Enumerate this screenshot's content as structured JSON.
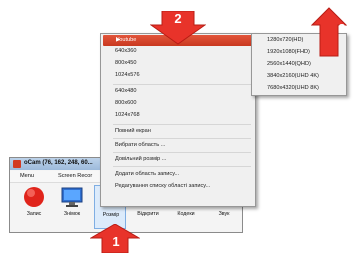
{
  "menu": {
    "highlighted_item": "Youtube",
    "items_group1": [
      "640x360",
      "800x450",
      "1024x576"
    ],
    "items_group2": [
      "640x480",
      "800x600",
      "1024x768"
    ],
    "fullscreen": "Повний екран",
    "select_area": "Вибрати область ...",
    "custom_size": "Довільний розмір ...",
    "add_area": "Додати область запису...",
    "edit_list": "Редагування списку області запису..."
  },
  "submenu": {
    "items": [
      "1280x720(HD)",
      "1920x1080(FHD)",
      "2560x1440(QHD)",
      "3840x2160(UHD 4K)",
      "7680x4320(UHD 8K)"
    ]
  },
  "window": {
    "title": "oCam (76, 162, 248, 60...",
    "tabs": [
      "Menu",
      "Screen Recor"
    ]
  },
  "toolbar": {
    "record": "Запис",
    "snapshot": "Знімок",
    "size": "Розмір",
    "open": "Відкрити",
    "codecs": "Кодеки",
    "sound": "Звук"
  },
  "callouts": [
    "1",
    "2",
    "3"
  ],
  "colors": {
    "highlight": "#d9472d",
    "callout_arrow": "#e8332a",
    "record_red": "#e0241b"
  }
}
